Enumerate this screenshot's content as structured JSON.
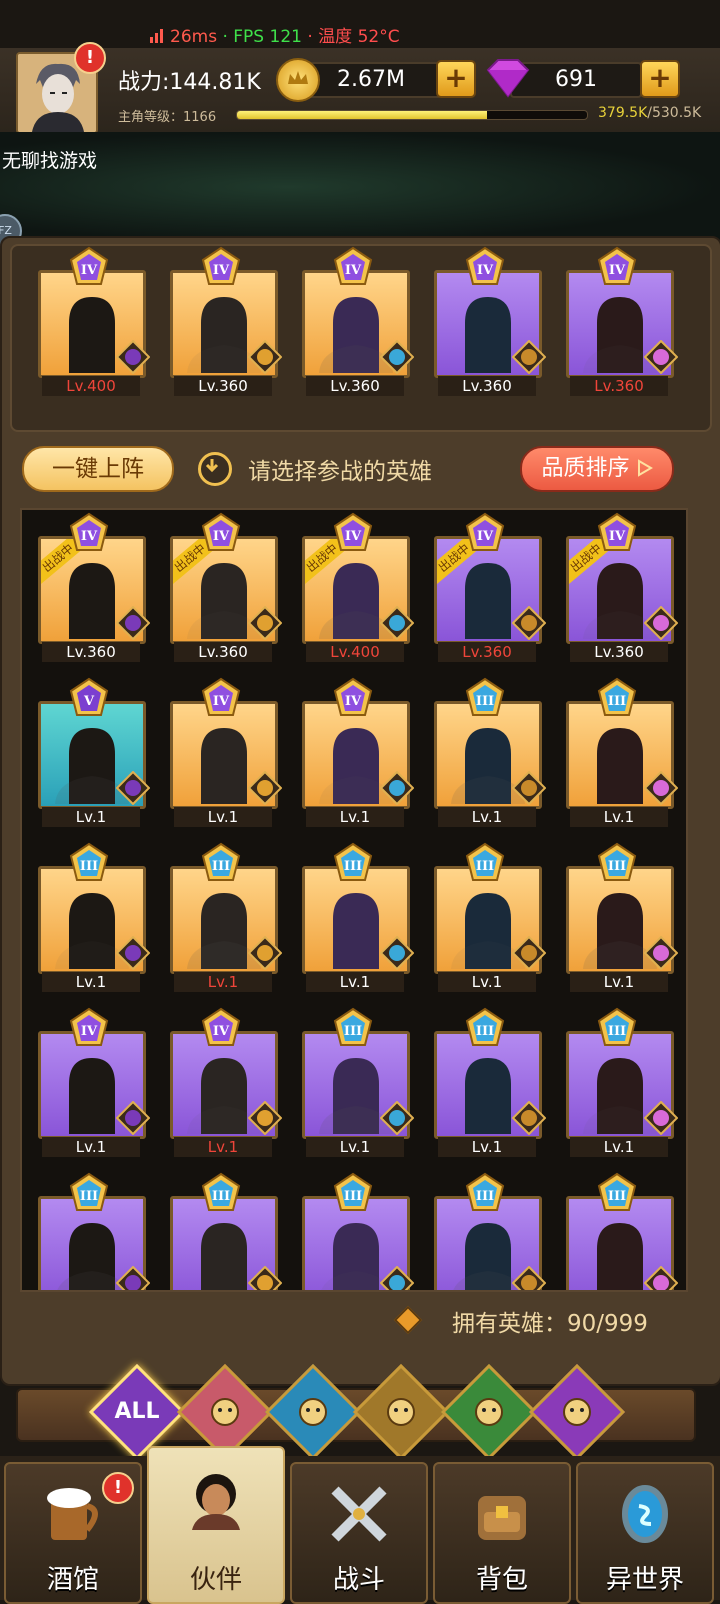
{
  "perf": {
    "ms": "26ms",
    "fps": "FPS 121",
    "temp": "温度 52°C",
    "sep": "·"
  },
  "header": {
    "power": "战力:144.81K",
    "gold": "2.67M",
    "gems": "691",
    "plus": "+",
    "level_label": "主角等级：1166",
    "xp_current": "379.5K",
    "xp_max": "/530.5K",
    "xp_fraction": 0.715,
    "alert": "!"
  },
  "subtitle": "无聊找游戏",
  "side_bubble": "FZ",
  "lineup": [
    {
      "level": "Lv.400",
      "red": true,
      "bg": "gold",
      "rank": "IV"
    },
    {
      "level": "Lv.360",
      "red": false,
      "bg": "gold",
      "rank": "IV"
    },
    {
      "level": "Lv.360",
      "red": false,
      "bg": "gold",
      "rank": "IV"
    },
    {
      "level": "Lv.360",
      "red": false,
      "bg": "purple",
      "rank": "IV"
    },
    {
      "level": "Lv.360",
      "red": true,
      "bg": "purple",
      "rank": "IV"
    }
  ],
  "controls": {
    "auto_deploy": "一键上阵",
    "prompt": "请选择参战的英雄",
    "sort": "品质排序"
  },
  "deployed_flag": "出战中",
  "heroes": [
    {
      "level": "Lv.360",
      "red": false,
      "bg": "gold",
      "rank": "IV",
      "deployed": true
    },
    {
      "level": "Lv.360",
      "red": false,
      "bg": "gold",
      "rank": "IV",
      "deployed": true
    },
    {
      "level": "Lv.400",
      "red": true,
      "bg": "gold",
      "rank": "IV",
      "deployed": true
    },
    {
      "level": "Lv.360",
      "red": true,
      "bg": "purple",
      "rank": "IV",
      "deployed": true
    },
    {
      "level": "Lv.360",
      "red": false,
      "bg": "purple",
      "rank": "IV",
      "deployed": true
    },
    {
      "level": "Lv.1",
      "red": false,
      "bg": "teal",
      "rank": "V",
      "deployed": false
    },
    {
      "level": "Lv.1",
      "red": false,
      "bg": "gold",
      "rank": "IV",
      "deployed": false
    },
    {
      "level": "Lv.1",
      "red": false,
      "bg": "gold",
      "rank": "IV",
      "deployed": false
    },
    {
      "level": "Lv.1",
      "red": false,
      "bg": "gold",
      "rank": "III",
      "deployed": false
    },
    {
      "level": "Lv.1",
      "red": false,
      "bg": "gold",
      "rank": "III",
      "deployed": false
    },
    {
      "level": "Lv.1",
      "red": false,
      "bg": "gold",
      "rank": "III",
      "deployed": false
    },
    {
      "level": "Lv.1",
      "red": true,
      "bg": "gold",
      "rank": "III",
      "deployed": false
    },
    {
      "level": "Lv.1",
      "red": false,
      "bg": "gold",
      "rank": "III",
      "deployed": false
    },
    {
      "level": "Lv.1",
      "red": false,
      "bg": "gold",
      "rank": "III",
      "deployed": false
    },
    {
      "level": "Lv.1",
      "red": false,
      "bg": "gold",
      "rank": "III",
      "deployed": false
    },
    {
      "level": "Lv.1",
      "red": false,
      "bg": "purple",
      "rank": "IV",
      "deployed": false
    },
    {
      "level": "Lv.1",
      "red": true,
      "bg": "purple",
      "rank": "IV",
      "deployed": false
    },
    {
      "level": "Lv.1",
      "red": false,
      "bg": "purple",
      "rank": "III",
      "deployed": false
    },
    {
      "level": "Lv.1",
      "red": false,
      "bg": "purple",
      "rank": "III",
      "deployed": false
    },
    {
      "level": "Lv.1",
      "red": false,
      "bg": "purple",
      "rank": "III",
      "deployed": false
    },
    {
      "level": "",
      "red": false,
      "bg": "purple",
      "rank": "III",
      "deployed": false
    },
    {
      "level": "",
      "red": false,
      "bg": "purple",
      "rank": "III",
      "deployed": false
    },
    {
      "level": "",
      "red": false,
      "bg": "purple",
      "rank": "III",
      "deployed": false
    },
    {
      "level": "",
      "red": false,
      "bg": "purple",
      "rank": "III",
      "deployed": false
    },
    {
      "level": "",
      "red": false,
      "bg": "purple",
      "rank": "III",
      "deployed": false
    }
  ],
  "owned": "拥有英雄：90/999",
  "filters": [
    {
      "label": "ALL",
      "icon": "all-filter",
      "selected": true
    },
    {
      "label": "",
      "icon": "crown-faction-icon",
      "selected": false
    },
    {
      "label": "",
      "icon": "fish-faction-icon",
      "selected": false
    },
    {
      "label": "",
      "icon": "lion-faction-icon",
      "selected": false
    },
    {
      "label": "",
      "icon": "elf-faction-icon",
      "selected": false
    },
    {
      "label": "",
      "icon": "demon-faction-icon",
      "selected": false
    }
  ],
  "nav": [
    {
      "label": "酒馆",
      "icon": "beer-mug-icon",
      "selected": false,
      "alert": "!"
    },
    {
      "label": "伙伴",
      "icon": "companion-icon",
      "selected": true
    },
    {
      "label": "战斗",
      "icon": "crossed-swords-icon",
      "selected": false
    },
    {
      "label": "背包",
      "icon": "backpack-icon",
      "selected": false
    },
    {
      "label": "异世界",
      "icon": "portal-icon",
      "selected": false
    }
  ],
  "colors": {
    "gold_card": "#f0a13a",
    "purple_card": "#8a55d8",
    "teal_card": "#2aa0b8",
    "red_level": "#f0453a"
  }
}
